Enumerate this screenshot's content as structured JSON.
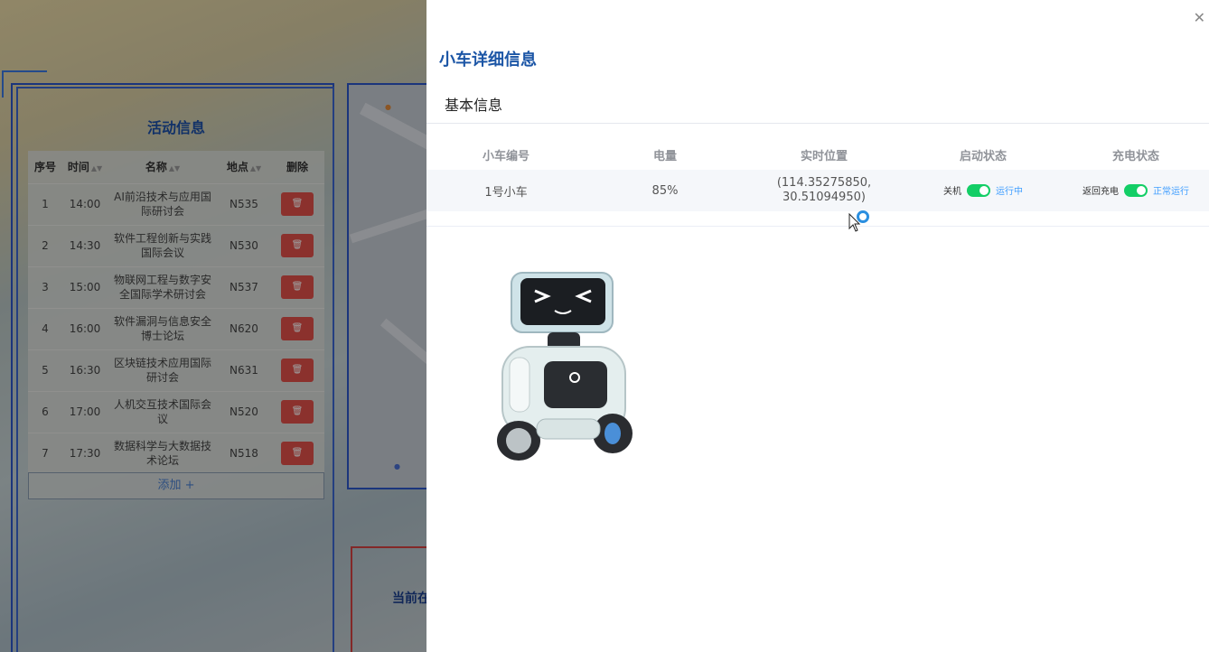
{
  "background": {
    "activity_panel": {
      "title": "活动信息",
      "columns": [
        "序号",
        "时间",
        "名称",
        "地点",
        "删除"
      ],
      "rows": [
        {
          "no": "1",
          "time": "14:00",
          "name": "AI前沿技术与应用国际研讨会",
          "place": "N535"
        },
        {
          "no": "2",
          "time": "14:30",
          "name": "软件工程创新与实践国际会议",
          "place": "N530"
        },
        {
          "no": "3",
          "time": "15:00",
          "name": "物联网工程与数字安全国际学术研讨会",
          "place": "N537"
        },
        {
          "no": "4",
          "time": "16:00",
          "name": "软件漏洞与信息安全博士论坛",
          "place": "N620"
        },
        {
          "no": "5",
          "time": "16:30",
          "name": "区块链技术应用国际研讨会",
          "place": "N631"
        },
        {
          "no": "6",
          "time": "17:00",
          "name": "人机交互技术国际会议",
          "place": "N520"
        },
        {
          "no": "7",
          "time": "17:30",
          "name": "数据科学与大数据技术论坛",
          "place": "N518"
        }
      ],
      "add_label": "添加 +"
    },
    "bottom_title": "当前在"
  },
  "drawer": {
    "title": "小车详细信息",
    "section": "基本信息",
    "columns": [
      "小车编号",
      "电量",
      "实时位置",
      "启动状态",
      "充电状态"
    ],
    "row": {
      "car_id": "1号小车",
      "battery": "85%",
      "position": "(114.35275850, 30.51094950)",
      "start_off_label": "关机",
      "start_on_label": "运行中",
      "start_on": true,
      "charge_off_label": "返回充电",
      "charge_on_label": "正常运行",
      "charge_on": true
    }
  },
  "colors": {
    "title_blue": "#1c56a6",
    "switch_on": "#13ce66",
    "delete_red": "#e0504a",
    "link_blue": "#409eff"
  }
}
